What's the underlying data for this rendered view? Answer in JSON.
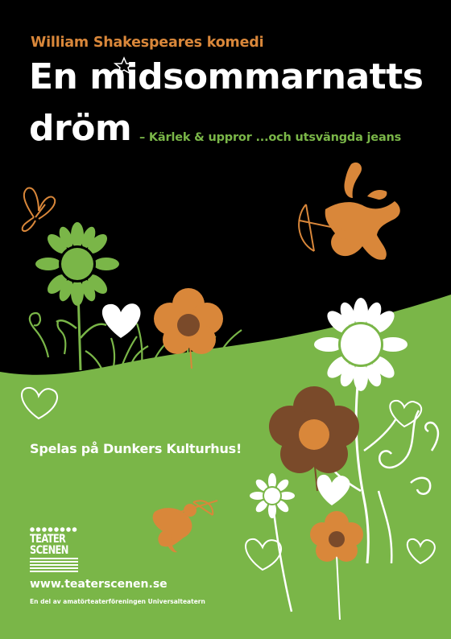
{
  "poster": {
    "kicker": "William Shakespeares komedi",
    "title_line1": "En midsommarnatts",
    "title_line2": "dröm",
    "subtitle": "– Kärlek & uppror ...och utsvängda jeans",
    "venue": "Spelas på Dunkers Kulturhus!",
    "website": "www.teaterscenen.se",
    "affiliation": "En del av amatörteaterföreningen Universalteatern"
  },
  "logo": {
    "line1": "TEATER",
    "line2": "SCENEN"
  },
  "colors": {
    "background": "#000000",
    "meadow": "#7ab648",
    "orange": "#d9873a",
    "brown": "#7a4a2a",
    "white": "#ffffff"
  }
}
